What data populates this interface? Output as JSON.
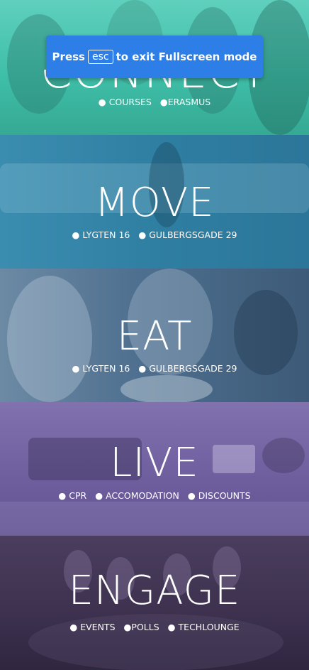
{
  "fullscreen_toast": {
    "before": "Press",
    "key": "esc",
    "after": "to exit Fullscreen mode"
  },
  "panels": [
    {
      "id": "connect",
      "title": "CONNECT",
      "tint": "#3ec6b0",
      "links": [
        "COURSES",
        "ERASMUS"
      ]
    },
    {
      "id": "move",
      "title": "MOVE",
      "tint": "#2f7fa3",
      "links": [
        "LYGTEN 16",
        "GULBERGSGADE 29"
      ]
    },
    {
      "id": "eat",
      "title": "EAT",
      "tint": "#4e6f8f",
      "links": [
        "LYGTEN 16",
        "GULBERGSGADE 29"
      ]
    },
    {
      "id": "live",
      "title": "LIVE",
      "tint": "#6f5f9f",
      "links": [
        "CPR",
        "ACCOMODATION",
        "DISCOUNTS"
      ]
    },
    {
      "id": "engage",
      "title": "ENGAGE",
      "tint": "#3e3250",
      "links": [
        "EVENTS",
        "POLLS",
        "TECHLOUNGE"
      ]
    }
  ]
}
